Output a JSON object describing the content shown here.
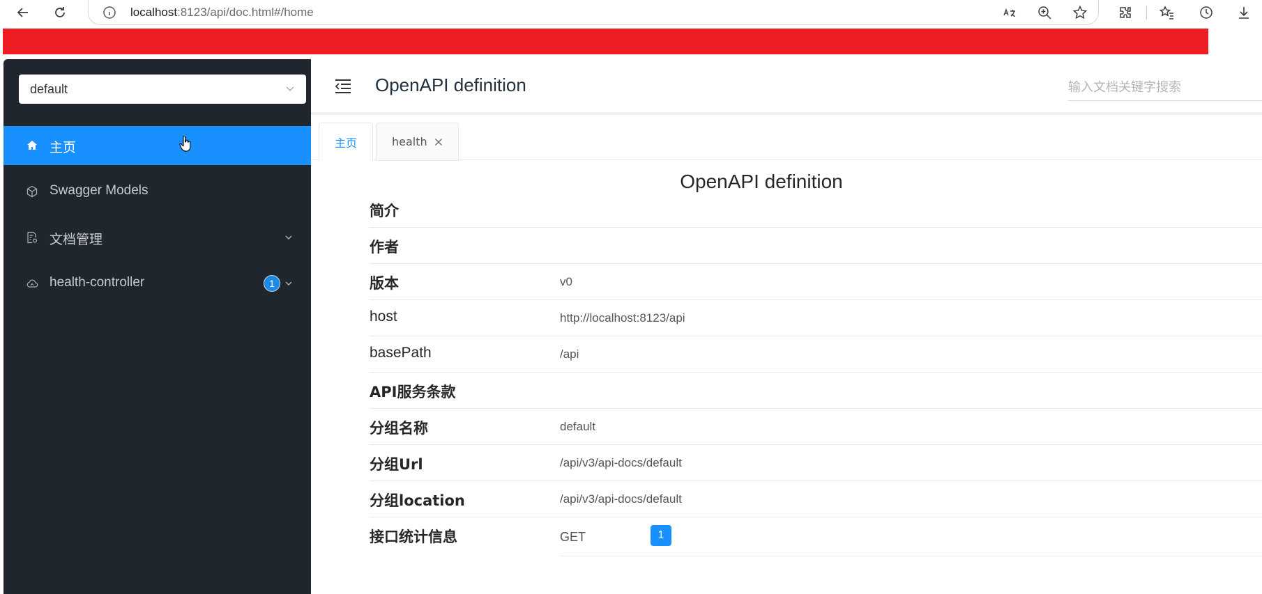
{
  "browser": {
    "url_host": "localhost",
    "url_rest": ":8123/api/doc.html#/home"
  },
  "colors": {
    "banner": "#ee1d24",
    "sidebar_bg": "#1f262d",
    "accent": "#1890ff"
  },
  "sidebar": {
    "group_select_value": "default",
    "items": [
      {
        "label": "主页",
        "icon": "home-icon",
        "active": true
      },
      {
        "label": "Swagger Models",
        "icon": "cube-icon"
      },
      {
        "label": "文档管理",
        "icon": "document-settings-icon",
        "expandable": true
      },
      {
        "label": "health-controller",
        "icon": "cloud-icon",
        "badge": "1",
        "expandable": true
      }
    ]
  },
  "header": {
    "title": "OpenAPI definition",
    "search_placeholder": "输入文档关键字搜索"
  },
  "tabs": [
    {
      "label": "主页",
      "active": true
    },
    {
      "label": "health",
      "closable": true
    }
  ],
  "doc": {
    "title": "OpenAPI definition",
    "rows": [
      {
        "label": "简介",
        "value": ""
      },
      {
        "label": "作者",
        "value": ""
      },
      {
        "label": "版本",
        "value": "v0"
      },
      {
        "label": "host",
        "value": "http://localhost:8123/api"
      },
      {
        "label": "basePath",
        "value": "/api"
      },
      {
        "label": "API服务条款",
        "value": ""
      },
      {
        "label": "分组名称",
        "value": "default"
      },
      {
        "label": "分组Url",
        "value": "/api/v3/api-docs/default"
      },
      {
        "label": "分组location",
        "value": "/api/v3/api-docs/default"
      }
    ],
    "stats_label": "接口统计信息",
    "stats": [
      {
        "method": "GET",
        "count": "1"
      }
    ]
  }
}
